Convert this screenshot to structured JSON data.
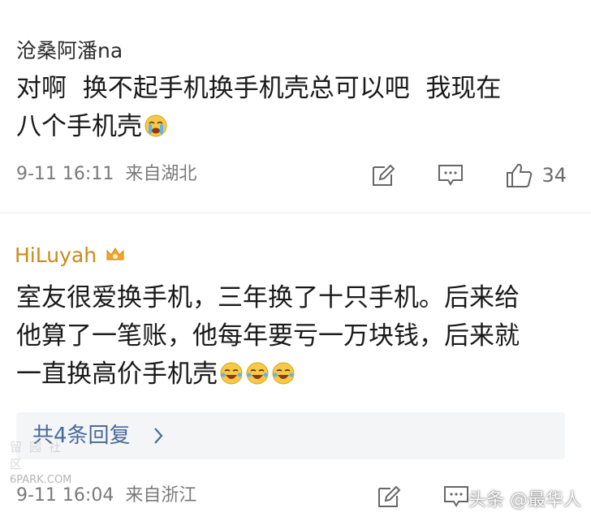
{
  "comments": [
    {
      "username": "沧桑阿潘na",
      "lines": [
        "对啊  换不起手机换手机壳总可以吧  我现在",
        "八个手机壳"
      ],
      "time": "9-11 16:11",
      "location": "来自湖北",
      "likes": "34",
      "emoji": "crying-face-emoji"
    },
    {
      "username": "HiLuyah",
      "badge": "crown-badge",
      "lines": [
        "室友很爱换手机，三年换了十只手机。后来给",
        "他算了一笔账，他每年要亏一万块钱，后来就",
        "一直换高价手机壳"
      ],
      "emoji": "laughing-crying-emoji",
      "replies_label": "共4条回复",
      "time": "9-11 16:04",
      "location": "来自浙江"
    }
  ],
  "watermark_left_cn": "留园社区",
  "watermark_left_en": "6PARK.COM",
  "watermark_right": "头条 @最华人",
  "colors": {
    "username_gold": "#c98a1e",
    "reply_link": "#4a6a9a",
    "meta_gray": "#7a7a7a"
  }
}
